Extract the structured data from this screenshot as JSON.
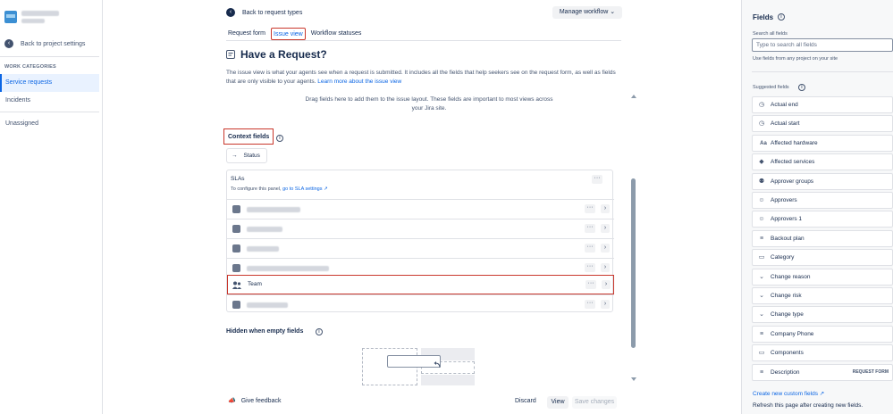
{
  "sidebar": {
    "back_label": "Back to project settings",
    "section_label": "WORK CATEGORIES",
    "items": [
      {
        "label": "Service requests"
      },
      {
        "label": "Incidents"
      },
      {
        "label": "Unassigned"
      }
    ]
  },
  "main": {
    "back_label": "Back to request types",
    "manage_label": "Manage workflow",
    "tabs": [
      {
        "label": "Request form"
      },
      {
        "label": "Issue view"
      },
      {
        "label": "Workflow statuses"
      }
    ],
    "title": "Have a Request?",
    "description": "The issue view is what your agents see when a request is submitted. It includes all the fields that help seekers see on the request form, as well as fields that are only visible to your agents.",
    "learn_more": "Learn more about the issue view",
    "drag_hint": "Drag fields here to add them to the issue layout. These fields are important to most views across your Jira site.",
    "context_label": "Context fields",
    "status_chip": "Status",
    "sla_title": "SLAs",
    "sla_sub": "To configure this panel,",
    "sla_link": "go to SLA settings",
    "team_label": "Team",
    "hidden_label": "Hidden when empty fields",
    "feedback_label": "Give feedback",
    "discard_label": "Discard",
    "view_label": "View",
    "save_label": "Save changes"
  },
  "right": {
    "title": "Fields",
    "search_label": "Search all fields",
    "search_placeholder": "Type to search all fields",
    "search_help": "Use fields from any project on your site",
    "suggested_label": "Suggested fields",
    "fields": [
      {
        "label": "Actual end",
        "icon": "clock-icon"
      },
      {
        "label": "Actual start",
        "icon": "clock-icon"
      },
      {
        "label": "Affected hardware",
        "icon": "text-icon"
      },
      {
        "label": "Affected services",
        "icon": "tag-icon"
      },
      {
        "label": "Approver groups",
        "icon": "group-icon"
      },
      {
        "label": "Approvers",
        "icon": "person-icon"
      },
      {
        "label": "Approvers 1",
        "icon": "person-icon"
      },
      {
        "label": "Backout plan",
        "icon": "paragraph-icon"
      },
      {
        "label": "Category",
        "icon": "folder-icon"
      },
      {
        "label": "Change reason",
        "icon": "dropdown-icon"
      },
      {
        "label": "Change risk",
        "icon": "dropdown-icon"
      },
      {
        "label": "Change type",
        "icon": "dropdown-icon"
      },
      {
        "label": "Company Phone",
        "icon": "paragraph-icon"
      },
      {
        "label": "Components",
        "icon": "folder-icon"
      },
      {
        "label": "Description",
        "icon": "paragraph-icon",
        "badge": "REQUEST FORM"
      }
    ],
    "create_link": "Create new custom fields",
    "refresh_text": "Refresh this page after creating new fields."
  }
}
